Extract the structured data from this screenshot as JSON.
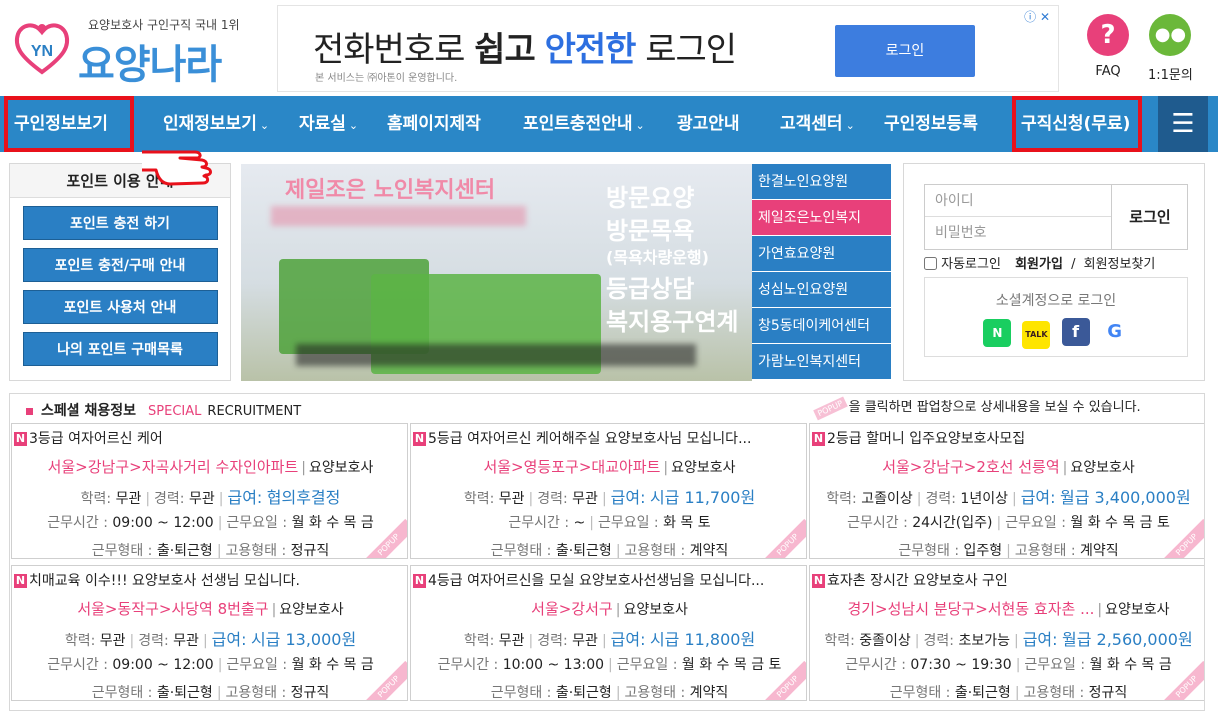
{
  "header": {
    "slogan": "요양보호사 구인구직 국내 1위",
    "logo_text": "요양나라",
    "logo_badge": "YN",
    "ad": {
      "headline_1": "전화번호로",
      "headline_2": "쉽고",
      "headline_3": "안전한",
      "headline_4": "로그인",
      "sub": "본 서비스는 ㈜아톤이 운영합니다.",
      "button": "로그인",
      "adchoice": "ⓘ ✕"
    },
    "faq_label": "FAQ",
    "qna_label": "1:1문의"
  },
  "nav": {
    "items": [
      {
        "label": "구인정보보기",
        "caret": ""
      },
      {
        "label": "인재정보보기",
        "caret": "⌄"
      },
      {
        "label": "자료실",
        "caret": "⌄"
      },
      {
        "label": "홈페이지제작",
        "caret": ""
      },
      {
        "label": "포인트충전안내",
        "caret": "⌄"
      },
      {
        "label": "광고안내",
        "caret": ""
      },
      {
        "label": "고객센터",
        "caret": "⌄"
      },
      {
        "label": "구인정보등록",
        "caret": ""
      },
      {
        "label": "구직신청(무료)",
        "caret": ""
      }
    ],
    "menu_icon": "☰"
  },
  "point_panel": {
    "title": "포인트 이용 안내",
    "buttons": [
      "포인트 충전 하기",
      "포인트 충전/구매 안내",
      "포인트 사용처 안내",
      "나의 포인트 구매목록"
    ]
  },
  "banner": {
    "facility": "제일조은 노인복지센터",
    "services": [
      "방문요양",
      "방문목욕",
      "(목욕차량운행)",
      "등급상담",
      "복지용구연계"
    ]
  },
  "side_list": [
    "한결노인요양원",
    "제일조은노인복지",
    "가연효요양원",
    "성심노인요양원",
    "창5동데이케어센터",
    "가람노인복지센터"
  ],
  "login": {
    "id_placeholder": "아이디",
    "pw_placeholder": "비밀번호",
    "button": "로그인",
    "auto_login": "자동로그인",
    "join": "회원가입",
    "slash": "/",
    "find": "회원정보찾기",
    "social_title": "소셜계정으로 로그인",
    "social": [
      {
        "label": "N",
        "color": "#19ce60",
        "icon": "naver-icon"
      },
      {
        "label": "TALK",
        "color": "#fee500",
        "icon": "kakao-icon"
      },
      {
        "label": "f",
        "color": "#3b5998",
        "icon": "facebook-icon"
      },
      {
        "label": "G",
        "color": "#ffffff",
        "icon": "google-icon"
      }
    ]
  },
  "special": {
    "title": "스페셜 채용정보",
    "en1": "SPECIAL",
    "en2": "RECRUITMENT",
    "note": "을 클릭하면 팝업창으로 상세내용을 보실 수 있습니다.",
    "note_tag": "POPUP",
    "labels": {
      "edu": "학력:",
      "career": "경력:",
      "pay": "급여:",
      "hours": "근무시간 :",
      "days": "근무요일 :",
      "work_type": "근무형태 :",
      "emp_type": "고용형태 :",
      "role_sep": "|",
      "badge": "N",
      "popup": "POPUP"
    },
    "cards": [
      {
        "title": "3등급 여자어르신 케어",
        "loc": "서울>강남구>자곡사거리 수자인아파트",
        "role": "요양보호사",
        "edu": "무관",
        "career": "무관",
        "pay": "협의후결정",
        "hours": "09:00 ~ 12:00",
        "days": "월 화 수 목 금",
        "work_type": "출·퇴근형",
        "emp_type": "정규직"
      },
      {
        "title": "5등급 여자어르신 케어해주실 요양보호사님 모십니다...",
        "loc": "서울>영등포구>대교아파트",
        "role": "요양보호사",
        "edu": "무관",
        "career": "무관",
        "pay": "시급 11,700원",
        "hours": "~",
        "days": "화 목 토",
        "work_type": "출·퇴근형",
        "emp_type": "계약직"
      },
      {
        "title": "2등급 할머니 입주요양보호사모집",
        "loc": "서울>강남구>2호선 선릉역",
        "role": "요양보호사",
        "edu": "고졸이상",
        "career": "1년이상",
        "pay": "월급 3,400,000원",
        "hours": "24시간(입주)",
        "days": "월 화 수 목 금 토",
        "work_type": "입주형",
        "emp_type": "계약직"
      },
      {
        "title": "치매교육 이수!!! 요양보호사 선생님 모십니다.",
        "loc": "서울>동작구>사당역 8번출구",
        "role": "요양보호사",
        "edu": "무관",
        "career": "무관",
        "pay": "시급 13,000원",
        "hours": "09:00 ~ 12:00",
        "days": "월 화 수 목 금",
        "work_type": "출·퇴근형",
        "emp_type": "정규직"
      },
      {
        "title": "4등급 여자어르신을 모실 요양보호사선생님을 모십니다...",
        "loc": "서울>강서구",
        "role": "요양보호사",
        "edu": "무관",
        "career": "무관",
        "pay": "시급 11,800원",
        "hours": "10:00 ~ 13:00",
        "days": "월 화 수 목 금 토",
        "work_type": "출·퇴근형",
        "emp_type": "계약직"
      },
      {
        "title": "효자촌 장시간 요양보호사 구인",
        "loc": "경기>성남시 분당구>서현동 효자촌 ...",
        "role": "요양보호사",
        "edu": "중졸이상",
        "career": "초보가능",
        "pay": "월급 2,560,000원",
        "hours": "07:30 ~ 19:30",
        "days": "월 화 수 목 금",
        "work_type": "출·퇴근형",
        "emp_type": "정규직"
      }
    ]
  },
  "colors": {
    "nav": "#2a87c7",
    "accent_pink": "#e8407a",
    "highlight_red": "#e8111b"
  }
}
